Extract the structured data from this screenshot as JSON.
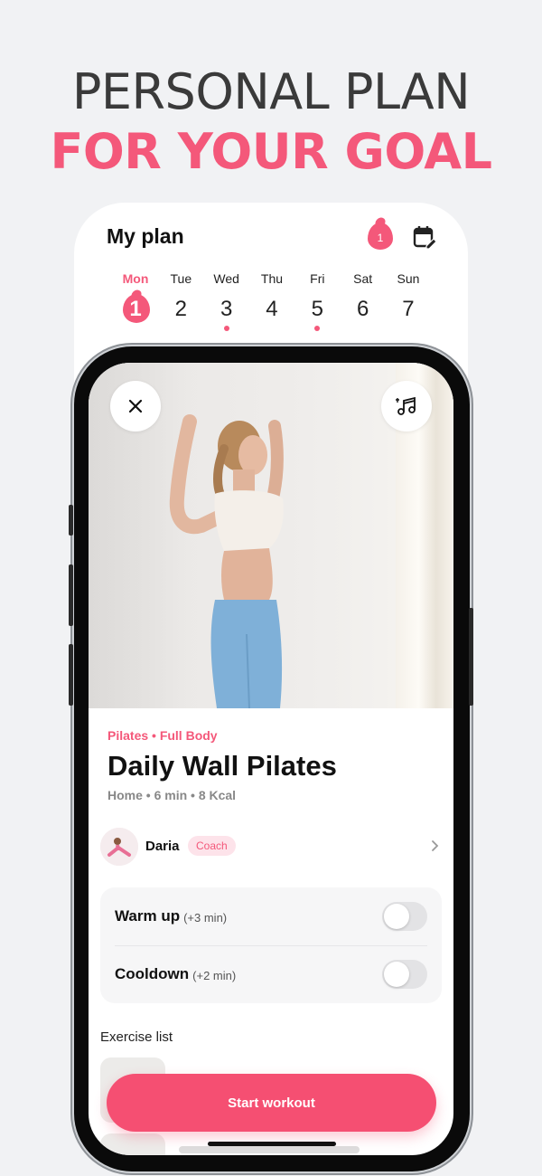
{
  "headline": {
    "line1": "PERSONAL PLAN",
    "line2": "FOR YOUR GOAL"
  },
  "plan": {
    "title": "My plan",
    "streak_count": "1",
    "days": [
      {
        "name": "Mon",
        "date": "1",
        "active": true,
        "dot": false
      },
      {
        "name": "Tue",
        "date": "2",
        "active": false,
        "dot": false
      },
      {
        "name": "Wed",
        "date": "3",
        "active": false,
        "dot": true
      },
      {
        "name": "Thu",
        "date": "4",
        "active": false,
        "dot": false
      },
      {
        "name": "Fri",
        "date": "5",
        "active": false,
        "dot": true
      },
      {
        "name": "Sat",
        "date": "6",
        "active": false,
        "dot": false
      },
      {
        "name": "Sun",
        "date": "7",
        "active": false,
        "dot": false
      }
    ]
  },
  "workout": {
    "tags": "Pilates • Full Body",
    "title": "Daily Wall Pilates",
    "meta": "Home • 6 min • 8 Kcal",
    "coach_name": "Daria",
    "coach_badge": "Coach",
    "warmup_label": "Warm up",
    "warmup_extra": "(+3 min)",
    "cooldown_label": "Cooldown",
    "cooldown_extra": "(+2 min)",
    "exercise_list_title": "Exercise list",
    "start_label": "Start workout"
  },
  "colors": {
    "accent": "#f4587a",
    "start_button": "#f54f72",
    "background": "#f1f2f4"
  },
  "icons": [
    "flame-icon",
    "calendar-edit-icon",
    "close-icon",
    "music-icon",
    "chevron-right-icon"
  ]
}
